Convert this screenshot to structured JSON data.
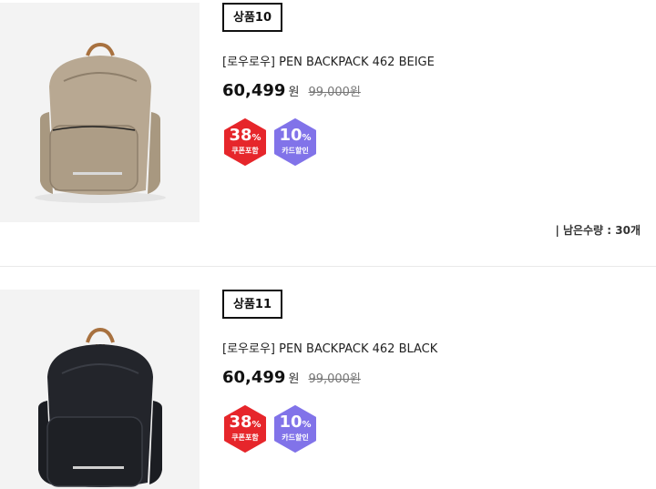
{
  "products": [
    {
      "badge": "상품10",
      "name": "[로우로우] PEN BACKPACK 462 BEIGE",
      "price": "60,499",
      "currency": "원",
      "original_price": "99,000원",
      "coupon_percent": "38",
      "coupon_unit": "%",
      "coupon_label": "쿠폰포함",
      "card_percent": "10",
      "card_unit": "%",
      "card_label": "카드할인",
      "stock_label": "남은수량 : 30개",
      "bag_color": "#b8a892",
      "image_icon": "beige-backpack-image"
    },
    {
      "badge": "상품11",
      "name": "[로우로우] PEN BACKPACK 462 BLACK",
      "price": "60,499",
      "currency": "원",
      "original_price": "99,000원",
      "coupon_percent": "38",
      "coupon_unit": "%",
      "coupon_label": "쿠폰포함",
      "card_percent": "10",
      "card_unit": "%",
      "card_label": "카드할인",
      "bag_color": "#23252b",
      "image_icon": "black-backpack-image"
    }
  ],
  "colors": {
    "coupon_hex": "#e6262b",
    "card_hex": "#8173e9",
    "divider": "#e9e9e9"
  }
}
